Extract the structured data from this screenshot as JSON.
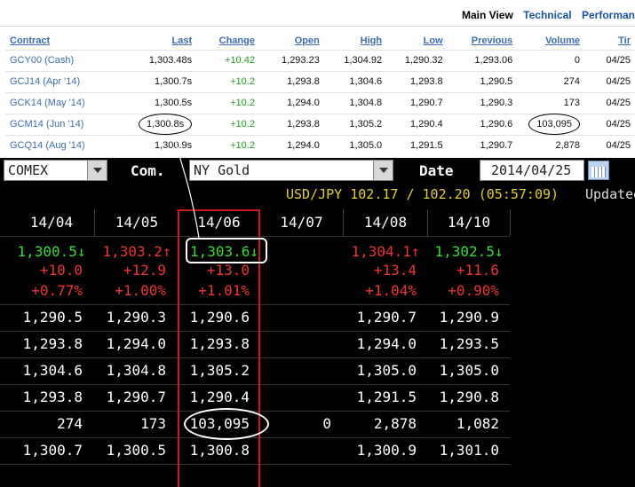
{
  "view_tabs": [
    "Main View",
    "Technical",
    "Performan"
  ],
  "quotes": {
    "columns": [
      "Contract",
      "Last",
      "Change",
      "Open",
      "High",
      "Low",
      "Previous",
      "Volume",
      "Tir"
    ],
    "rows": [
      {
        "contract": "GCY00 (Cash)",
        "last": "1,303.48s",
        "change": "+10.42",
        "open": "1,293.23",
        "high": "1,304.92",
        "low": "1,290.32",
        "previous": "1,293.06",
        "volume": "0",
        "time": "04/25"
      },
      {
        "contract": "GCJ14 (Apr '14)",
        "last": "1,300.7s",
        "change": "+10.2",
        "open": "1,293.8",
        "high": "1,304.6",
        "low": "1,293.8",
        "previous": "1,290.5",
        "volume": "274",
        "time": "04/25"
      },
      {
        "contract": "GCK14 (May '14)",
        "last": "1,300.5s",
        "change": "+10.2",
        "open": "1,294.0",
        "high": "1,304.8",
        "low": "1,290.7",
        "previous": "1,290.3",
        "volume": "173",
        "time": "04/25"
      },
      {
        "contract": "GCM14 (Jun '14)",
        "last": "1,300.8s",
        "change": "+10.2",
        "open": "1,293.8",
        "high": "1,305.2",
        "low": "1,290.4",
        "previous": "1,290.6",
        "volume": "103,095",
        "time": "04/25"
      },
      {
        "contract": "GCQ14 (Aug '14)",
        "last": "1,300.9s",
        "change": "+10.2",
        "open": "1,294.0",
        "high": "1,305.0",
        "low": "1,291.5",
        "previous": "1,290.7",
        "volume": "2,878",
        "time": "04/25"
      }
    ]
  },
  "toolbar": {
    "exchange": "COMEX",
    "com_label": "Com.",
    "commodity": "NY Gold",
    "date_label": "Date",
    "date_value": "2014/04/25"
  },
  "ticker": {
    "fx": "USD/JPY 102.17 / 102.20 (05:57:09)",
    "updated": "Updated"
  },
  "grid": {
    "months": [
      "14/04",
      "14/05",
      "14/06",
      "14/07",
      "14/08",
      "14/10"
    ],
    "prices": [
      {
        "value": "1,300.5↓",
        "dir": "down"
      },
      {
        "value": "1,303.2↑",
        "dir": "up"
      },
      {
        "value": "1,303.6↓",
        "dir": "down"
      },
      {
        "value": "",
        "dir": ""
      },
      {
        "value": "1,304.1↑",
        "dir": "up"
      },
      {
        "value": "1,302.5↓",
        "dir": "down"
      }
    ],
    "changes": [
      "+10.0",
      "+12.9",
      "+13.0",
      "",
      "+13.4",
      "+11.6"
    ],
    "change_pcts": [
      "+0.77%",
      "+1.00%",
      "+1.01%",
      "",
      "+1.04%",
      "+0.90%"
    ],
    "rows": [
      [
        "1,290.5",
        "1,290.3",
        "1,290.6",
        "",
        "1,290.7",
        "1,290.9"
      ],
      [
        "1,293.8",
        "1,294.0",
        "1,293.8",
        "",
        "1,294.0",
        "1,293.5"
      ],
      [
        "1,304.6",
        "1,304.8",
        "1,305.2",
        "",
        "1,305.0",
        "1,305.0"
      ],
      [
        "1,293.8",
        "1,290.7",
        "1,290.4",
        "",
        "1,291.5",
        "1,290.8"
      ],
      [
        "274",
        "173",
        "103,095",
        "0",
        "2,878",
        "1,082"
      ],
      [
        "1,300.7",
        "1,300.5",
        "1,300.8",
        "",
        "1,300.9",
        "1,301.0"
      ]
    ]
  },
  "colors": {
    "up_green": "#33dd33",
    "down_red": "#ee3333",
    "highlight_border": "#d01818",
    "link_blue": "#3b6eae"
  }
}
